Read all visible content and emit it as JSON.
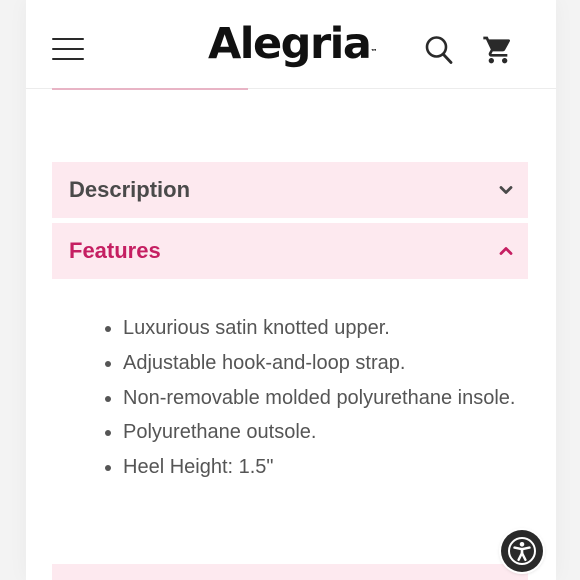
{
  "header": {
    "brand": "Alegria",
    "trademark": "™",
    "icons": {
      "menu": "hamburger-menu-icon",
      "search": "search-icon",
      "cart": "shopping-cart-icon"
    }
  },
  "accordions": [
    {
      "title": "Description",
      "expanded": false,
      "icon": "chevron-down-icon"
    },
    {
      "title": "Features",
      "expanded": true,
      "icon": "chevron-up-icon"
    }
  ],
  "features": [
    "Luxurious satin knotted upper.",
    "Adjustable hook-and-loop strap.",
    "Non-removable molded polyurethane insole.",
    "Polyurethane outsole.",
    "Heel Height: 1.5\""
  ],
  "accessibility": {
    "icon": "accessibility-icon"
  },
  "colors": {
    "accent": "#c51f62",
    "accordion_bg": "#fde9ef",
    "text": "#555555",
    "heading_inactive": "#4a4a4a"
  }
}
